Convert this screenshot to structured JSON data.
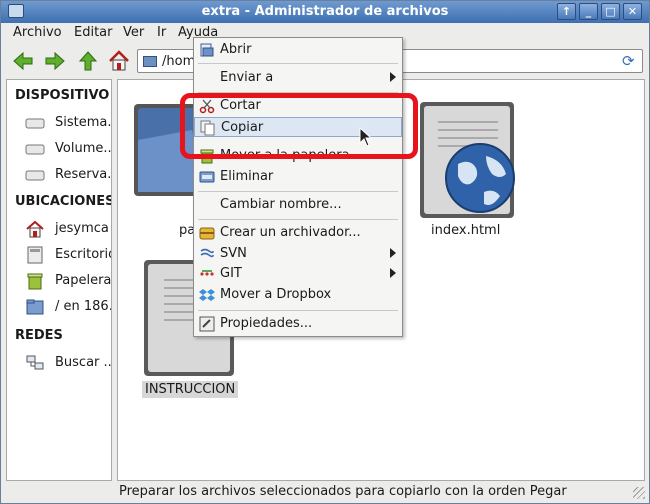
{
  "window": {
    "title": "extra - Administrador de archivos"
  },
  "titlebar_buttons": [
    "↑",
    "_",
    "□",
    "✕"
  ],
  "menubar": [
    "Archivo",
    "Editar",
    "Ver",
    "Ir",
    "Ayuda"
  ],
  "location": {
    "value": "/hom"
  },
  "sidebar": {
    "devices_header": "DISPOSITIVO",
    "devices": [
      "Sistema...",
      "Volume...",
      "Reserva..."
    ],
    "places_header": "UBICACIONES",
    "places": [
      "jesymca",
      "Escritorio",
      "Papelera",
      "/ en 186."
    ],
    "network_header": "REDES",
    "network": [
      "Buscar ..."
    ]
  },
  "files": [
    {
      "name": "pa"
    },
    {
      "name": "index.html"
    },
    {
      "name": "INSTRUCCION"
    }
  ],
  "context_menu": {
    "items": [
      {
        "label": "Abrir",
        "icon": "open-icon"
      },
      {
        "label": "Enviar a",
        "submenu": true
      },
      {
        "label": "Cortar",
        "icon": "scissors-icon"
      },
      {
        "label": "Copiar",
        "icon": "copy-icon"
      },
      {
        "label": "Mover a la papelera",
        "icon": "trash-icon"
      },
      {
        "label": "Eliminar",
        "icon": "delete-icon"
      },
      {
        "label": "Cambiar nombre..."
      },
      {
        "label": "Crear un archivador...",
        "icon": "archive-icon"
      },
      {
        "label": "SVN",
        "icon": "svn-icon",
        "submenu": true
      },
      {
        "label": "GIT",
        "icon": "git-icon",
        "submenu": true
      },
      {
        "label": "Mover a Dropbox",
        "icon": "dropbox-icon"
      },
      {
        "label": "Propiedades...",
        "icon": "properties-icon"
      }
    ]
  },
  "statusbar": {
    "message": "Preparar los archivos seleccionados para copiarlo con la orden Pegar"
  },
  "colors": {
    "highlight": "#e8141b",
    "titlebar": "#4f7fbf",
    "selection": "#dde7f4"
  }
}
